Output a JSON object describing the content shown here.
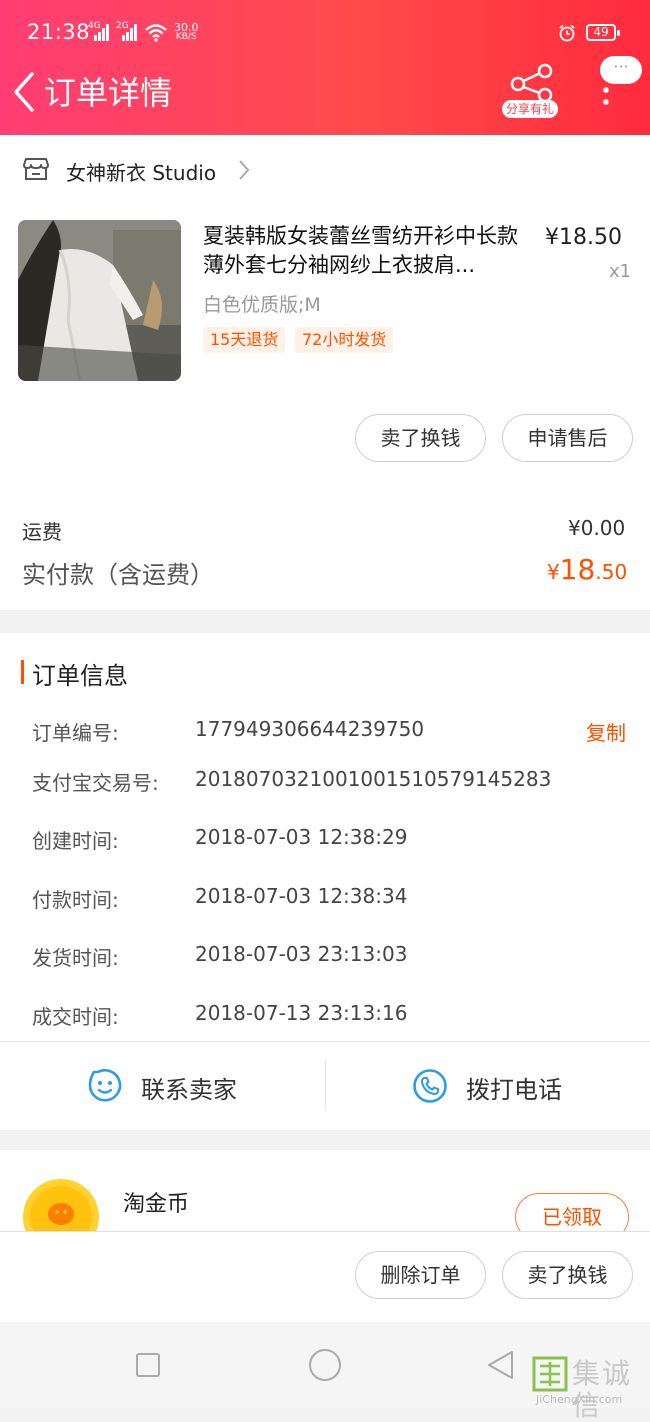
{
  "status_bar": {
    "time": "21:38",
    "signal_1": "4G",
    "signal_2": "2G",
    "net_speed_value": "30.0",
    "net_speed_unit": "KB/S",
    "battery": "49"
  },
  "header": {
    "title": "订单详情",
    "share_label": "分享有礼",
    "more_label": "···"
  },
  "shop": {
    "name": "女神新衣 Studio"
  },
  "product": {
    "name": "夏装韩版女装蕾丝雪纺开衫中长款薄外套七分袖网纱上衣披肩...",
    "price": "¥18.50",
    "quantity": "x1",
    "variant": "白色优质版;M",
    "tags": [
      "15天退货",
      "72小时发货"
    ],
    "actions": [
      "卖了换钱",
      "申请售后"
    ]
  },
  "payment": {
    "shipping_label": "运费",
    "shipping_value": "¥0.00",
    "total_label": "实付款（含运费）",
    "total_currency": "¥",
    "total_integer": "18",
    "total_decimal": ".50"
  },
  "order_info": {
    "section_title": "订单信息",
    "copy_label": "复制",
    "rows": [
      {
        "label": "订单编号:",
        "value": "177949306644239750"
      },
      {
        "label": "支付宝交易号:",
        "value": "2018070321001001510579145283"
      },
      {
        "label": "创建时间:",
        "value": "2018-07-03 12:38:29"
      },
      {
        "label": "付款时间:",
        "value": "2018-07-03 12:38:34"
      },
      {
        "label": "发货时间:",
        "value": "2018-07-03 23:13:03"
      },
      {
        "label": "成交时间:",
        "value": "2018-07-13 23:13:16"
      }
    ]
  },
  "contact": {
    "seller_label": "联系卖家",
    "phone_label": "拨打电话"
  },
  "coins": {
    "title": "淘金币",
    "claimed_label": "已领取"
  },
  "bottom_actions": {
    "delete_label": "删除订单",
    "resell_label": "卖了换钱"
  },
  "watermark": {
    "brand": "集诚信",
    "domain": "JiChengXin.com"
  },
  "colors": {
    "header_start": "#ff3d74",
    "header_end": "#ff2b3d",
    "accent": "#ff5000"
  }
}
